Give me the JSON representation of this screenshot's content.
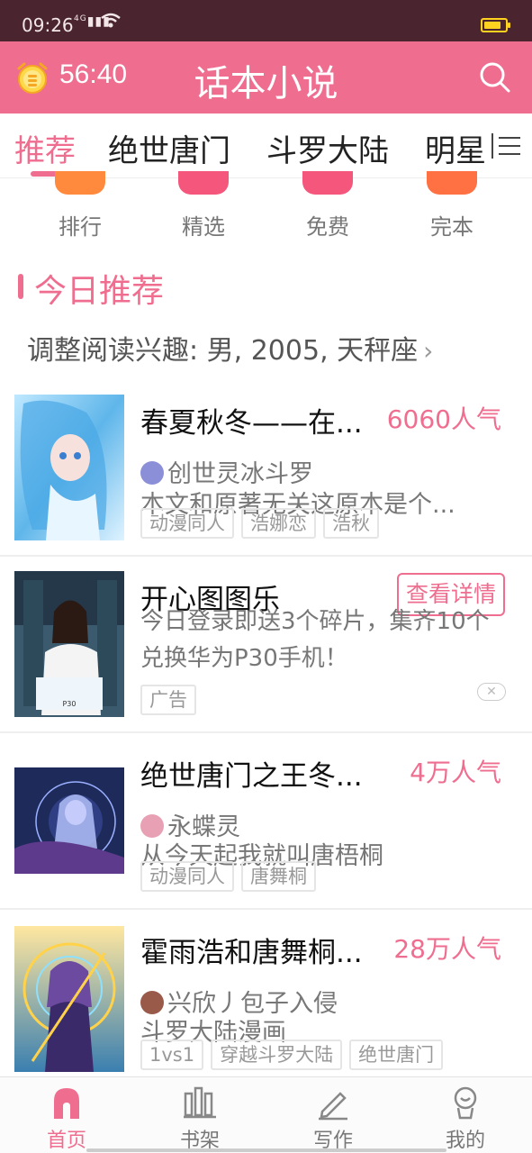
{
  "status_bar": {
    "time": "09:26",
    "signal": "4G",
    "battery_level": 0.8
  },
  "header": {
    "timer": "56:40",
    "title": "话本小说",
    "accent_color": "#ef6e8f"
  },
  "tabs": [
    {
      "label": "推荐",
      "active": true
    },
    {
      "label": "绝世唐门",
      "active": false
    },
    {
      "label": "斗罗大陆",
      "active": false
    },
    {
      "label": "明星",
      "active": false
    }
  ],
  "categories": [
    {
      "label": "排行",
      "icon": "ranking-icon",
      "color": "#ff8a3d"
    },
    {
      "label": "精选",
      "icon": "featured-icon",
      "color": "#f5577c"
    },
    {
      "label": "免费",
      "icon": "free-icon",
      "color": "#f5577c"
    },
    {
      "label": "完本",
      "icon": "finished-icon",
      "color": "#ff7043"
    }
  ],
  "section": {
    "title": "今日推荐",
    "interest_text": "调整阅读兴趣: 男, 2005, 天秤座"
  },
  "items": [
    {
      "title": "春夏秋冬——在...",
      "popularity": "6060人气",
      "author": "创世灵冰斗罗",
      "description": "本文和原著无关这原本是个...",
      "tags": [
        "动漫同人",
        "浩娜恋",
        "浩秋"
      ]
    },
    {
      "title": "开心图图乐",
      "button": "查看详情",
      "description": "今日登录即送3个碎片，集齐10个兑换华为P30手机！",
      "tag": "广告",
      "is_ad": true
    },
    {
      "title": "绝世唐门之王冬...",
      "popularity": "4万人气",
      "author": "永蝶灵",
      "description": "从今天起我就叫唐梧桐",
      "tags": [
        "动漫同人",
        "唐舞桐"
      ]
    },
    {
      "title": "霍雨浩和唐舞桐...",
      "popularity": "28万人气",
      "author": "兴欣丿包子入侵",
      "description": "斗罗大陆漫画",
      "tags": [
        "1vs1",
        "穿越斗罗大陆",
        "绝世唐门"
      ]
    }
  ],
  "bottom_nav": [
    {
      "label": "首页",
      "icon": "home-icon",
      "active": true
    },
    {
      "label": "书架",
      "icon": "bookshelf-icon",
      "active": false
    },
    {
      "label": "写作",
      "icon": "pen-icon",
      "active": false
    },
    {
      "label": "我的",
      "icon": "profile-icon",
      "active": false
    }
  ]
}
